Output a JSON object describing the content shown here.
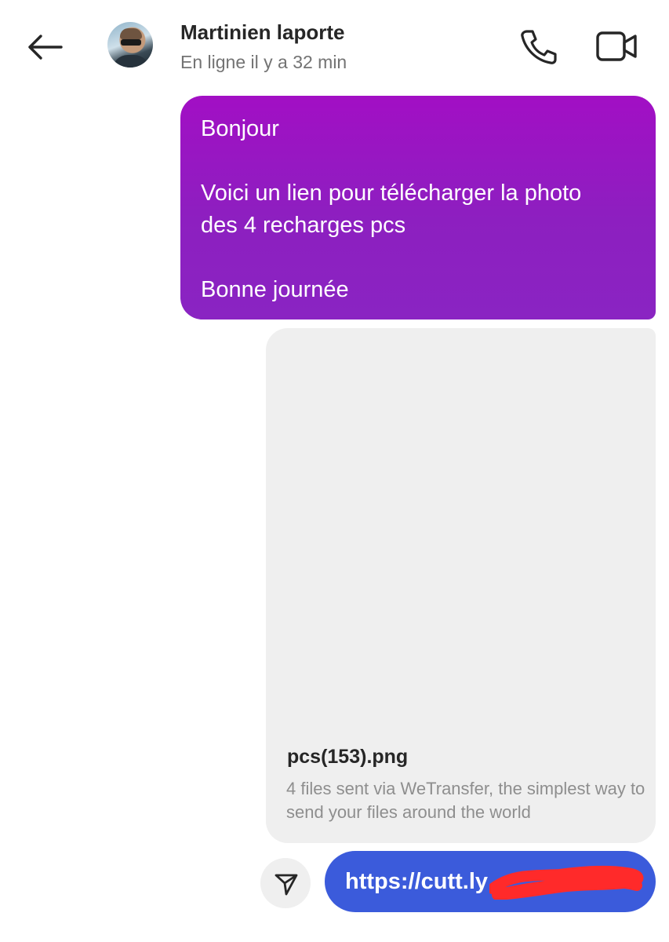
{
  "header": {
    "contact_name": "Martinien laporte",
    "status": "En ligne il y a 32 min",
    "icons": {
      "back": "back-arrow-icon",
      "call": "phone-icon",
      "video": "video-camera-icon"
    }
  },
  "messages": {
    "text_bubble": {
      "lines": [
        "Bonjour",
        "",
        "Voici un lien pour télécharger la photo",
        "des 4 recharges pcs",
        "",
        "Bonne journée"
      ],
      "gradient": [
        "#a20fc4",
        "#8a24c2"
      ]
    },
    "attachment": {
      "title": "pcs(153).png",
      "description": "4 files sent via WeTransfer, the simplest way to send your files around the world"
    },
    "link": {
      "text": "https://cutt.ly",
      "redaction_color": "#ff2a2a",
      "bubble_color": "#3b5bdb"
    }
  },
  "colors": {
    "attachment_bg": "#efefef",
    "text_primary": "#262626",
    "text_secondary": "#737373"
  }
}
